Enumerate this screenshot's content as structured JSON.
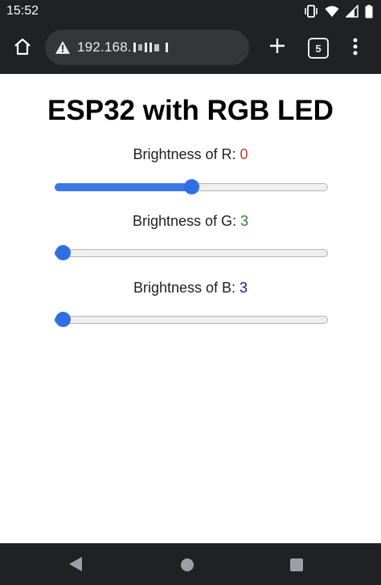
{
  "status_bar": {
    "time": "15:52",
    "icons": [
      "vibrate-icon",
      "wifi-icon",
      "cellular-signal-icon",
      "battery-icon"
    ]
  },
  "browser": {
    "url": "192.168.",
    "tab_count": "5",
    "icons": [
      "home-icon",
      "warning-icon",
      "plus-icon",
      "more-vert-icon"
    ]
  },
  "page": {
    "title": "ESP32 with RGB LED",
    "sliders": [
      {
        "label": "Brightness of R: ",
        "value": "0",
        "level_percent": 50,
        "color": "#c0392b"
      },
      {
        "label": "Brightness of G: ",
        "value": "3",
        "level_percent": 3,
        "color": "#2e7d32"
      },
      {
        "label": "Brightness of B: ",
        "value": "3",
        "level_percent": 3,
        "color": "#1a237e"
      }
    ],
    "accent_color": "#2f6fe4"
  },
  "nav_bar": {
    "icons": [
      "back-icon",
      "home-circle-icon",
      "recents-icon"
    ]
  }
}
